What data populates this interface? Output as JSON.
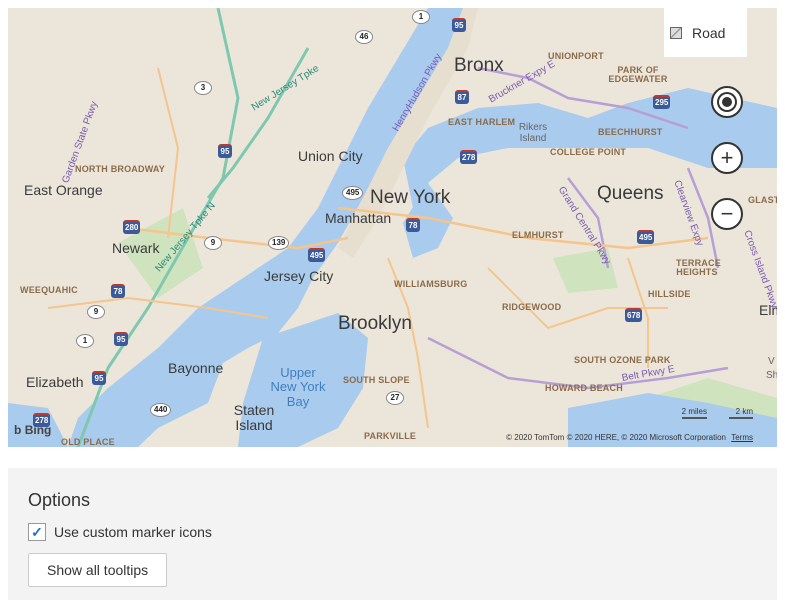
{
  "map": {
    "style_label": "Road",
    "cities": [
      "Bronx",
      "New York",
      "Queens",
      "Brooklyn",
      "Manhattan",
      "Union City",
      "East Orange",
      "Newark",
      "Jersey City",
      "Bayonne",
      "Staten Island",
      "Elizabeth",
      "Elm"
    ],
    "neighborhoods": [
      "NORTH BROADWAY",
      "EAST HARLEM",
      "COLLEGE POINT",
      "BEECHHURST",
      "PARK OF EDGEWATER",
      "UNIONPORT",
      "ELMHURST",
      "TERRACE HEIGHTS",
      "HILLSIDE",
      "WILLIAMSBURG",
      "RIDGEWOOD",
      "WEEQUAHIC",
      "SOUTH OZONE PARK",
      "HOWARD BEACH",
      "SOUTH SLOPE",
      "PARKVILLE",
      "OLD PLACE"
    ],
    "water": [
      "Upper New York Bay",
      "Rikers Island"
    ],
    "roads": [
      "New Jersey Tpke",
      "HenryHudson Pkwy",
      "Bruckner Expy E",
      "Garden State Pkwy",
      "Grand Central Pkwy",
      "Cross Island Pkwy",
      "Belt Pkwy E",
      "New Jersey Tpke N",
      "Clearview Expy"
    ],
    "shields": [
      "1",
      "46",
      "95",
      "3",
      "87",
      "295",
      "95",
      "278",
      "495",
      "280",
      "9",
      "139",
      "78",
      "495",
      "495",
      "78",
      "9",
      "1",
      "95",
      "678",
      "27",
      "440",
      "278",
      "95"
    ],
    "scale_miles": "2 miles",
    "scale_km": "2 km",
    "bing_label": "Bing",
    "copyright": "© 2020 TomTom © 2020 HERE, © 2020 Microsoft Corporation",
    "terms": "Terms",
    "v_cut": "V",
    "s_cut": "Sh",
    "glasto": "GLASTO"
  },
  "options": {
    "title": "Options",
    "checkbox_label": "Use custom marker icons",
    "checkbox_checked": true,
    "tooltips_button": "Show all tooltips"
  }
}
